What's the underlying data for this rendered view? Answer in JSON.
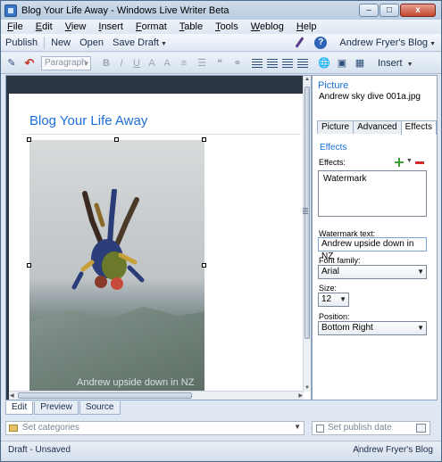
{
  "window": {
    "title": "Blog Your Life Away - Windows Live Writer Beta",
    "controls": {
      "minimize": "–",
      "maximize": "□",
      "close": "x"
    }
  },
  "menu": {
    "items": [
      {
        "u": "F",
        "rest": "ile"
      },
      {
        "u": "E",
        "rest": "dit"
      },
      {
        "u": "V",
        "rest": "iew"
      },
      {
        "u": "I",
        "rest": "nsert"
      },
      {
        "u": "F",
        "rest": "ormat"
      },
      {
        "u": "T",
        "rest": "able"
      },
      {
        "u": "T",
        "rest": "ools"
      },
      {
        "u": "W",
        "rest": "eblog"
      },
      {
        "u": "H",
        "rest": "elp"
      }
    ]
  },
  "commands": {
    "publish": "Publish",
    "new": "New",
    "open": "Open",
    "save_draft": "Save Draft",
    "blog_name": "Andrew Fryer's Blog",
    "help": "?"
  },
  "format_toolbar": {
    "paragraph": "Paragraph",
    "insert": "Insert",
    "letters": [
      "B",
      "I",
      "U",
      "A",
      "A"
    ]
  },
  "editor": {
    "post_title": "Blog Your Life Away",
    "watermark_overlay": "Andrew upside down in NZ"
  },
  "view_tabs": [
    "Edit",
    "Preview",
    "Source"
  ],
  "bottom": {
    "categories_placeholder": "Set categories",
    "publish_date_placeholder": "Set publish date"
  },
  "status": {
    "left": "Draft - Unsaved",
    "right": "Andrew Fryer's Blog"
  },
  "panel": {
    "title": "Picture",
    "file": "Andrew sky dive 001a.jpg",
    "tabs": [
      "Picture",
      "Advanced",
      "Effects"
    ],
    "section": "Effects",
    "effects_label": "Effects:",
    "effects_items": [
      "Watermark"
    ],
    "watermark_label": "Watermark text:",
    "watermark_value": "Andrew upside down in NZ",
    "font_family_label": "Font family:",
    "font_family_value": "Arial",
    "size_label": "Size:",
    "size_value": "12",
    "position_label": "Position:",
    "position_value": "Bottom Right"
  }
}
